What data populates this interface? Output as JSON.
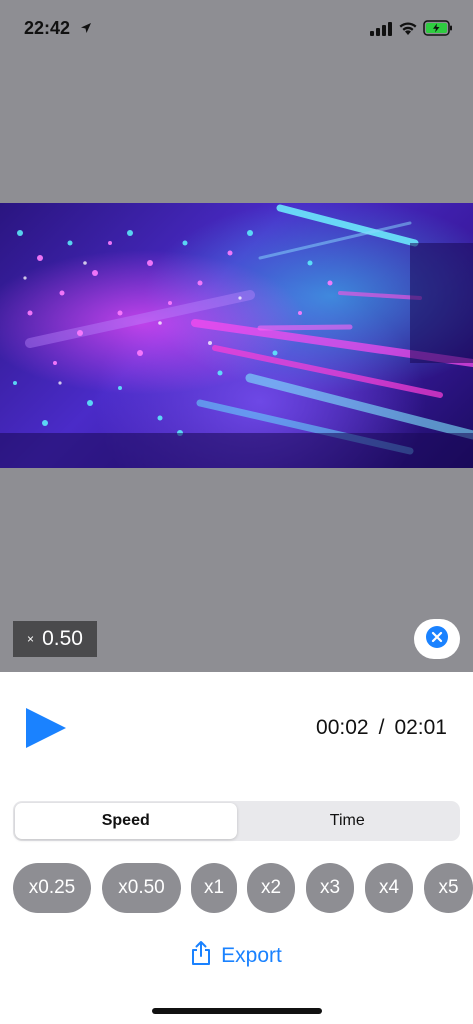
{
  "status_bar": {
    "time": "22:42"
  },
  "video": {
    "speed_badge_x": "×",
    "speed_badge_value": "0.50"
  },
  "player": {
    "current_time": "00:02",
    "separator": "/",
    "total_time": "02:01"
  },
  "mode_tabs": {
    "speed_label": "Speed",
    "time_label": "Time",
    "selected": "Speed"
  },
  "speed_options": [
    "x0.25",
    "x0.50",
    "x1",
    "x2",
    "x3",
    "x4",
    "x5"
  ],
  "export_label": "Export",
  "colors": {
    "accent": "#1a82ff",
    "chip_bg": "#8e8e93",
    "top_bg": "#8e8e93"
  }
}
